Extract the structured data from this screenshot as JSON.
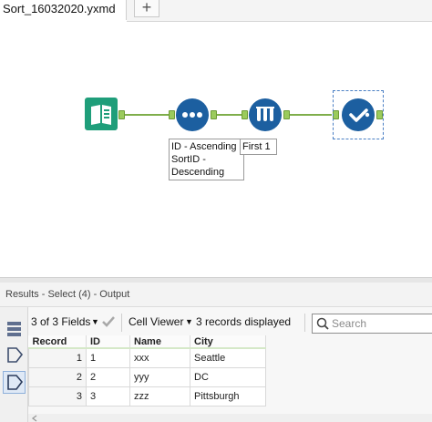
{
  "tabs": {
    "active_label": "Sort_16032020.yxmd",
    "new_tab_label": "+"
  },
  "workflow": {
    "tools": [
      {
        "name": "Input Data",
        "icon": "book-icon",
        "color": "#1f9e7a"
      },
      {
        "name": "Sort",
        "icon": "dots-sort-icon",
        "color": "#1c5fa0"
      },
      {
        "name": "Sample",
        "icon": "test-tubes-icon",
        "color": "#1c5fa0"
      },
      {
        "name": "Select",
        "icon": "checkmark-icon",
        "color": "#1c5fa0"
      }
    ],
    "sort_annotation": [
      "ID - Ascending",
      "SortID -",
      "Descending"
    ],
    "sample_annotation": "First 1"
  },
  "results": {
    "title": "Results - Select (4) - Output",
    "fields_label": "3 of 3 Fields",
    "viewer_label": "Cell Viewer",
    "records_label": "3 records displayed",
    "search_placeholder": "Search",
    "columns": [
      "Record",
      "ID",
      "Name",
      "City"
    ],
    "rows": [
      {
        "record": "1",
        "id": "1",
        "name": "xxx",
        "city": "Seattle"
      },
      {
        "record": "2",
        "id": "2",
        "name": "yyy",
        "city": "DC"
      },
      {
        "record": "3",
        "id": "3",
        "name": "zzz",
        "city": "Pittsburgh"
      }
    ]
  },
  "colors": {
    "accent_blue": "#1c5fa0",
    "input_teal": "#1f9e7a",
    "connection_green": "#7fae4b"
  }
}
